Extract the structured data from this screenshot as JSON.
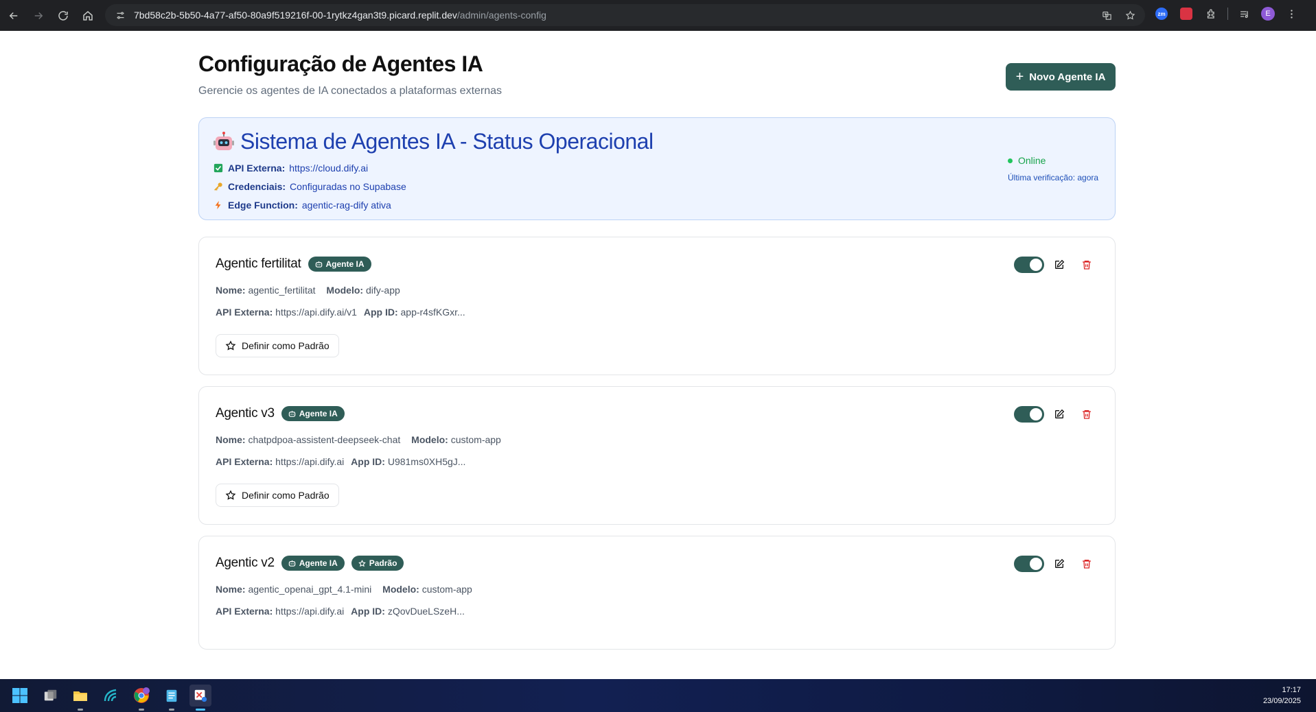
{
  "browser": {
    "url_host": "7bd58c2b-5b50-4a77-af50-80a9f519216f-00-1rytkz4gan3t9.picard.replit.dev",
    "url_path": "/admin/agents-config",
    "profile_initial": "E",
    "extension_zm_label": "zm"
  },
  "header": {
    "title": "Configuração de Agentes IA",
    "subtitle": "Gerencie os agentes de IA conectados a plataformas externas",
    "new_button_label": "Novo Agente IA"
  },
  "status_panel": {
    "title": "Sistema de Agentes IA - Status Operacional",
    "lines": [
      {
        "label": "API Externa:",
        "value": "https://cloud.dify.ai",
        "icon": "check-square-icon"
      },
      {
        "label": "Credenciais:",
        "value": "Configuradas no Supabase",
        "icon": "key-icon"
      },
      {
        "label": "Edge Function:",
        "value": "agentic-rag-dify ativa",
        "icon": "lightning-icon"
      }
    ],
    "status": "Online",
    "last_check": "Última verificação: agora"
  },
  "agents": [
    {
      "name": "Agentic fertilitat",
      "badge": "Agente IA",
      "nome_label": "Nome:",
      "nome": "agentic_fertilitat",
      "modelo_label": "Modelo:",
      "modelo": "dify-app",
      "api_label": "API Externa:",
      "api": "https://api.dify.ai/v1",
      "appid_label": "App ID:",
      "appid": "app-r4sfKGxr...",
      "default_button": "Definir como Padrão",
      "enabled": true
    },
    {
      "name": "Agentic v3",
      "badge": "Agente IA",
      "nome_label": "Nome:",
      "nome": "chatpdpoa-assistent-deepseek-chat",
      "modelo_label": "Modelo:",
      "modelo": "custom-app",
      "api_label": "API Externa:",
      "api": "https://api.dify.ai",
      "appid_label": "App ID:",
      "appid": "U981ms0XH5gJ...",
      "default_button": "Definir como Padrão",
      "enabled": true
    },
    {
      "name": "Agentic v2",
      "badge": "Agente IA",
      "default_badge": "Padrão",
      "nome_label": "Nome:",
      "nome": "agentic_openai_gpt_4.1-mini",
      "modelo_label": "Modelo:",
      "modelo": "custom-app",
      "api_label": "API Externa:",
      "api": "https://api.dify.ai",
      "appid_label": "App ID:",
      "appid": "zQovDueLSzeH...",
      "enabled": true
    }
  ],
  "taskbar": {
    "time": "17:17",
    "date": "23/09/2025",
    "apps": [
      "windows-start-icon",
      "task-view-icon",
      "file-explorer-icon",
      "app-wave-icon",
      "chrome-icon",
      "notepad-icon",
      "snipping-tool-icon"
    ]
  },
  "colors": {
    "accent": "#2f5d57",
    "status_bg": "#eef4ff",
    "status_text": "#1e40af",
    "online": "#16a34a",
    "delete": "#dc2626"
  }
}
